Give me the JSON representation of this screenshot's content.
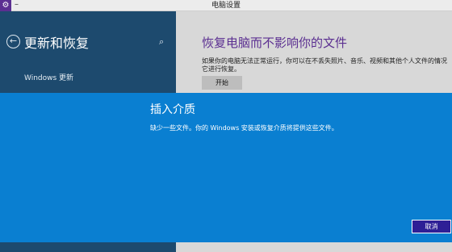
{
  "window": {
    "title": "电脑设置",
    "minimize_glyph": "–",
    "app_icon": "settings-gear-icon"
  },
  "sidebar": {
    "back_icon": "arrow-left-icon",
    "title": "更新和恢复",
    "search_icon": "search-icon",
    "items": [
      {
        "label": "Windows 更新"
      }
    ]
  },
  "main": {
    "heading": "恢复电脑而不影响你的文件",
    "description_line1": "如果你的电脑无法正常运行，你可以在不丢失照片、音乐、视频和其他个人文件的情况",
    "description_line2": "它进行恢复。",
    "start_button_label": "开始"
  },
  "dialog": {
    "title": "插入介质",
    "message": "缺少一些文件。你的 Windows 安装或恢复介质将提供这些文件。",
    "cancel_label": "取消"
  },
  "colors": {
    "accent_purple": "#5b2f91",
    "sidebar_bg": "#1d4a6e",
    "dialog_bg": "#0a7fd1",
    "cancel_bg": "#2e1f96"
  }
}
